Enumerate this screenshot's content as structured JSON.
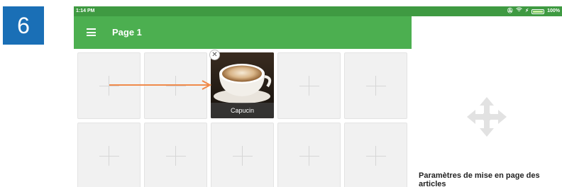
{
  "step_number": "6",
  "statusbar": {
    "time": "1:14 PM",
    "icons": [
      "bell-off-icon",
      "wifi-icon",
      "charging-icon",
      "battery-icon"
    ],
    "battery_percent": "100%"
  },
  "appbar": {
    "menu_icon": "hamburger-menu-icon",
    "title": "Page 1"
  },
  "grid": {
    "empty_slot_icon": "plus-icon",
    "placed_item": {
      "label": "Capucin",
      "image": "cappuccino-cup",
      "remove_icon": "close-icon"
    }
  },
  "annotation": {
    "arrow_color": "#f08a4b"
  },
  "side_panel": {
    "icon": "move-icon",
    "title": "Paramètres de mise en page des articles"
  },
  "colors": {
    "appbar": "#4caf50",
    "statusbar": "#3f9a42",
    "step_badge": "#1a6fb6"
  }
}
